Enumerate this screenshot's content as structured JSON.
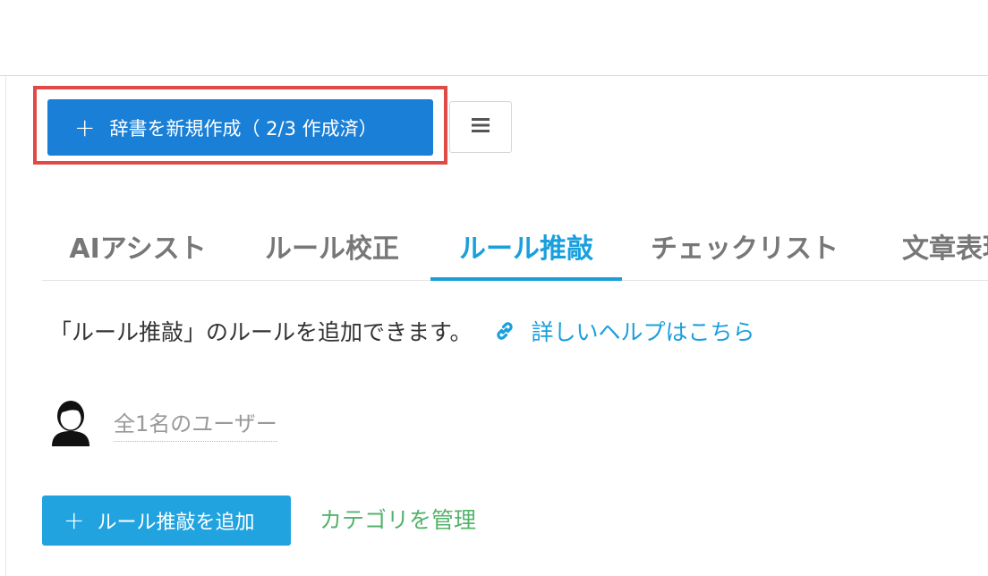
{
  "toolbar": {
    "create_dictionary_label": "辞書を新規作成（ 2/3 作成済）",
    "create_plus": "+",
    "menu_icon": "hamburger-menu-icon"
  },
  "tabs": [
    {
      "label": "AIアシスト",
      "active": false
    },
    {
      "label": "ルール校正",
      "active": false
    },
    {
      "label": "ルール推敲",
      "active": true
    },
    {
      "label": "チェックリスト",
      "active": false
    },
    {
      "label": "文章表現",
      "active": false
    }
  ],
  "description": {
    "text": "「ルール推敲」のルールを追加できます。",
    "help_link": "詳しいヘルプはこちら",
    "link_icon": "link-icon"
  },
  "users": {
    "avatar_icon": "user-avatar-icon",
    "count_label": "全1名のユーザー"
  },
  "actions": {
    "add_rule_label": "ルール推敲を追加",
    "add_plus": "+",
    "manage_category_label": "カテゴリを管理"
  },
  "colors": {
    "primary_button": "#1a7fd6",
    "add_button": "#21a3e0",
    "active_tab": "#1a9fdd",
    "link": "#1a9fdd",
    "category_link": "#54b36a",
    "highlight": "#e04a46"
  }
}
